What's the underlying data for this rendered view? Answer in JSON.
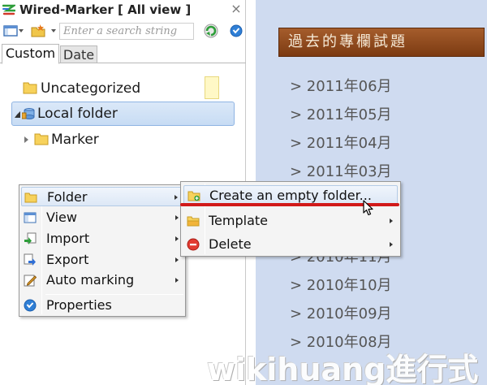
{
  "app": {
    "title": "Wired-Marker [ All view ]",
    "close_glyph": "×"
  },
  "toolbar": {
    "search_placeholder": "Enter a search string",
    "search_value": ""
  },
  "tabs": [
    {
      "label": "Custom",
      "active": true
    },
    {
      "label": "Date",
      "active": false
    }
  ],
  "tree": {
    "uncategorized": "Uncategorized",
    "local_folder": "Local folder",
    "marker": "Marker"
  },
  "context_menu": {
    "items": [
      {
        "label": "Folder",
        "icon": "folder-icon",
        "submenu": true,
        "highlighted": true
      },
      {
        "label": "View",
        "icon": "view-icon",
        "submenu": true
      },
      {
        "label": "Import",
        "icon": "import-icon",
        "submenu": true
      },
      {
        "label": "Export",
        "icon": "export-icon",
        "submenu": true
      },
      {
        "label": "Auto marking",
        "icon": "pencil-icon",
        "submenu": true
      },
      {
        "label": "Properties",
        "icon": "info-icon",
        "submenu": false
      }
    ]
  },
  "submenu": {
    "items": [
      {
        "label": "Create an empty folder...",
        "icon": "new-folder-icon",
        "highlighted": true
      },
      {
        "label": "Template",
        "icon": "template-folder-icon",
        "submenu": true
      },
      {
        "label": "Delete",
        "icon": "delete-icon",
        "submenu": true
      }
    ]
  },
  "blog": {
    "heading": "過去的專欄試題",
    "archive": [
      "> 2011年06月",
      "> 2011年05月",
      "> 2011年04月",
      "> 2011年03月",
      "> 2010年11月",
      "> 2010年10月",
      "> 2010年09月",
      "> 2010年08月"
    ],
    "watermark": "wikihuang進行式"
  },
  "colors": {
    "selection_bg": "#c7dcf4",
    "heading_bg": "#8b4719",
    "blog_bg": "#cfdbf0",
    "highlight_line": "#d11a1a"
  }
}
